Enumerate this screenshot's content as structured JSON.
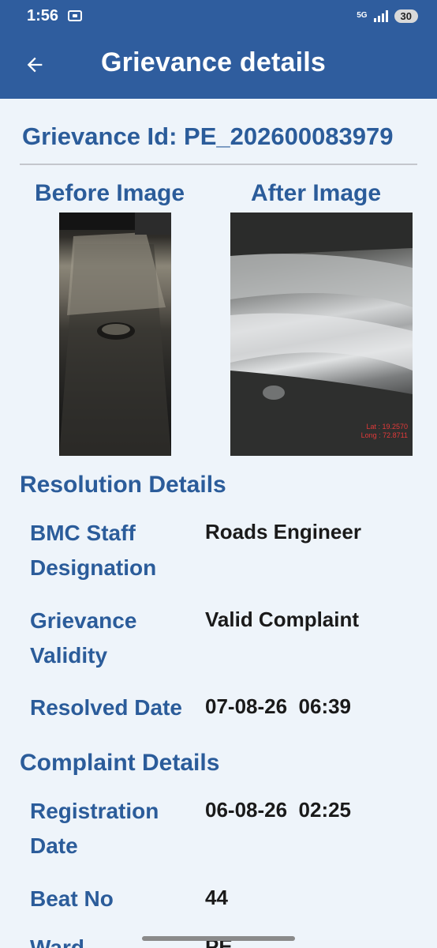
{
  "status_bar": {
    "time": "1:56",
    "network": "5G",
    "battery": "30",
    "icons": [
      "screen-record-icon",
      "signal-icon",
      "battery-icon"
    ]
  },
  "app_bar": {
    "title": "Grievance details",
    "back_icon": "arrow-left-icon"
  },
  "grievance": {
    "id_label": "Grievance Id: PE_202600083979"
  },
  "images": {
    "before_title": "Before Image",
    "after_title": "After Image",
    "after_overlay_lat": "Lat : 19.2570",
    "after_overlay_long": "Long : 72.8711"
  },
  "resolution": {
    "title": "Resolution Details",
    "rows": [
      {
        "label": "BMC Staff Designation",
        "value": "Roads Engineer"
      },
      {
        "label": "Grievance Validity",
        "value": "Valid Complaint"
      },
      {
        "label": "Resolved Date",
        "value": "07-08-26  06:39"
      }
    ]
  },
  "complaint": {
    "title": "Complaint Details",
    "rows": [
      {
        "label": "Registration Date",
        "value": "06-08-26  02:25"
      },
      {
        "label": "Beat No",
        "value": "44"
      },
      {
        "label": "Ward",
        "value": "PE"
      }
    ]
  },
  "colors": {
    "primary": "#2f5d9e",
    "label_blue": "#2b5c9a",
    "background": "#eef4fa"
  }
}
